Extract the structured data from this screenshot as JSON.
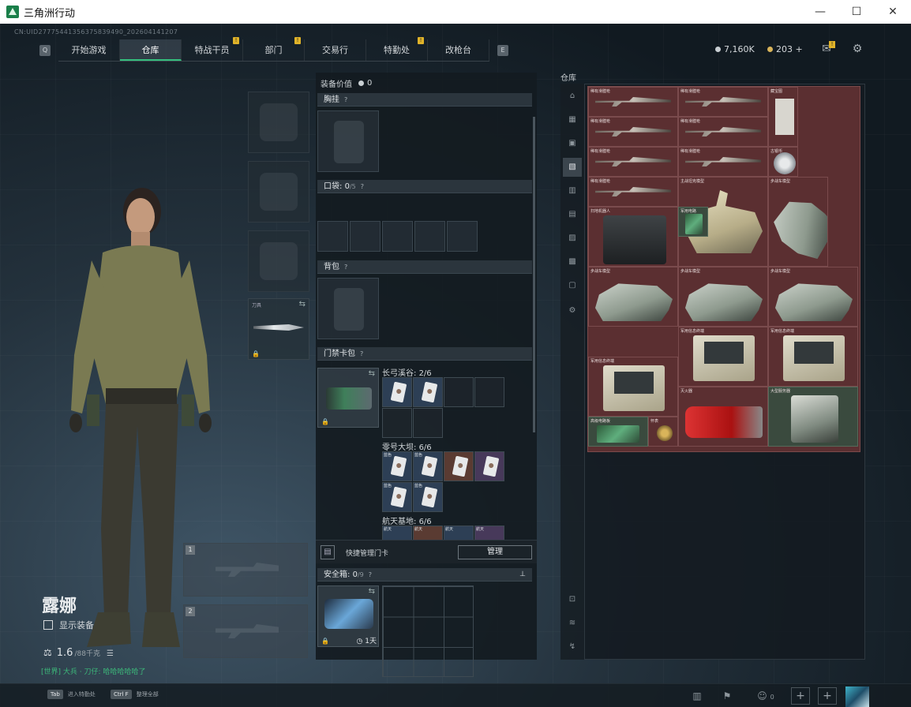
{
  "window": {
    "title": "三角洲行动",
    "controls": [
      "—",
      "☐",
      "✕"
    ]
  },
  "uid": "CN:UID27775441356375839490_202604141207",
  "nav": {
    "left_key": "Q",
    "right_key": "E",
    "tabs": [
      {
        "label": "开始游戏",
        "active": false,
        "alert": false
      },
      {
        "label": "仓库",
        "active": true,
        "alert": false
      },
      {
        "label": "特战干员",
        "active": false,
        "alert": true
      },
      {
        "label": "部门",
        "active": false,
        "alert": true
      },
      {
        "label": "交易行",
        "active": false,
        "alert": false
      },
      {
        "label": "特勤处",
        "active": false,
        "alert": true
      },
      {
        "label": "改枪台",
        "active": false,
        "alert": false
      }
    ],
    "alert_mark": "!"
  },
  "currency": {
    "hafcoin": "7,160K",
    "tickets": "203",
    "plus": "+"
  },
  "character": {
    "name": "露娜",
    "show_equipment": "显示装备",
    "weight": "1.6",
    "weight_max": "/88千克"
  },
  "chat": "[世界] 大兵 · 刀仔: 哈哈哈哈哈了",
  "bottom": {
    "hotkeys": [
      {
        "key": "Tab",
        "label": "进入特勤处"
      },
      {
        "key": "Ctrl F",
        "label": "整理全部"
      }
    ],
    "friends": "0"
  },
  "loadout": {
    "equip_value_label": "装备价值",
    "equip_value": "0",
    "chest_rig": "胸挂",
    "pockets_label": "口袋:",
    "pockets_value": "0",
    "pockets_max": "/5",
    "backpack": "背包",
    "keycase": "门禁卡包",
    "knife_label": "刀具",
    "maps": [
      {
        "name": "长弓溪谷:",
        "count": "2/6"
      },
      {
        "name": "零号大坝:",
        "count": "6/6"
      },
      {
        "name": "航天基地:",
        "count": "6/6"
      }
    ],
    "card_tags": {
      "dam": "蓝色",
      "base": "航天"
    },
    "quick_manage": "快捷管理门卡",
    "manage_btn": "管理",
    "safebox_label": "安全箱:",
    "safebox_value": "0",
    "safebox_max": "/9",
    "safebox_days": "1天",
    "help": "?"
  },
  "storage": {
    "label": "仓库",
    "items": {
      "rifle": "稀有滑膛枪",
      "map": "藏宝图",
      "coin": "古银币",
      "tank": "主战坦克模型",
      "ifv": "步战车模型",
      "robot": "扫地机器人",
      "pcb": "军用电路",
      "terminal": "军用信息终端",
      "extinguisher": "灭火器",
      "server": "大型服务器",
      "circuit": "高级电路板",
      "compass": "怀表"
    }
  }
}
